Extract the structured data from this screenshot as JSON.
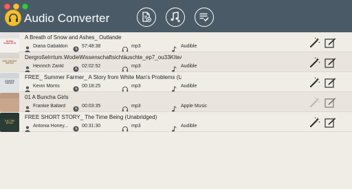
{
  "app": {
    "title": "Audio Converter"
  },
  "toolbar": {
    "add_files_icon": "add-file-icon",
    "add_music_icon": "add-music-icon",
    "list_icon": "checklist-icon"
  },
  "colors": {
    "titlebar": "#4a5b67",
    "background": "#f0ede7",
    "row_alt": "#e9e5de",
    "app_logo": "#f1c12c"
  },
  "items": [
    {
      "title": "A Breath of Snow and Ashes_ Outlande",
      "author": "Diana Gabaldon",
      "duration": "57:48:38",
      "format": "mp3",
      "source": "Audible",
      "cover": {
        "label": "DIANA GABALDON",
        "bg": "#f4f1ee",
        "fg": "#b3141b"
      },
      "enabled": true
    },
    {
      "title": "DergroßeIrrtum.WodieWissenschaftsichtäuschte_ep7_ou33KIteAr...",
      "author": "Heinrich Zankl",
      "duration": "02:02:52",
      "format": "mp3",
      "source": "Audible",
      "cover": {
        "label": "DER GROSSE IRRTUM",
        "bg": "#e9e4da",
        "fg": "#7c4a1d"
      },
      "enabled": true
    },
    {
      "title": "FREE_ Summer Farmer_ A Story from White Man's Problems (Una...",
      "author": "Kevin Morris",
      "duration": "00:18:25",
      "format": "mp3",
      "source": "Audible",
      "cover": {
        "label": "SUMMER FARMER",
        "bg": "#dfe3e6",
        "fg": "#22313f"
      },
      "enabled": true
    },
    {
      "title": "01 A Buncha Girls",
      "author": "Frankie Ballard",
      "duration": "00:03:35",
      "format": "mp3",
      "source": "Apple Music",
      "cover": {
        "label": "",
        "bg": "#c8a58c",
        "fg": "#5b3a28"
      },
      "enabled": false
    },
    {
      "title": "FREE SHORT STORY_ The Time Being (Unabridged)",
      "author": "Antonia Honey...",
      "duration": "00:31:30",
      "format": "mp3",
      "source": "Audible",
      "cover": {
        "label": "THE TIME BEING",
        "bg": "#2b3c35",
        "fg": "#e8c659"
      },
      "enabled": true
    }
  ]
}
